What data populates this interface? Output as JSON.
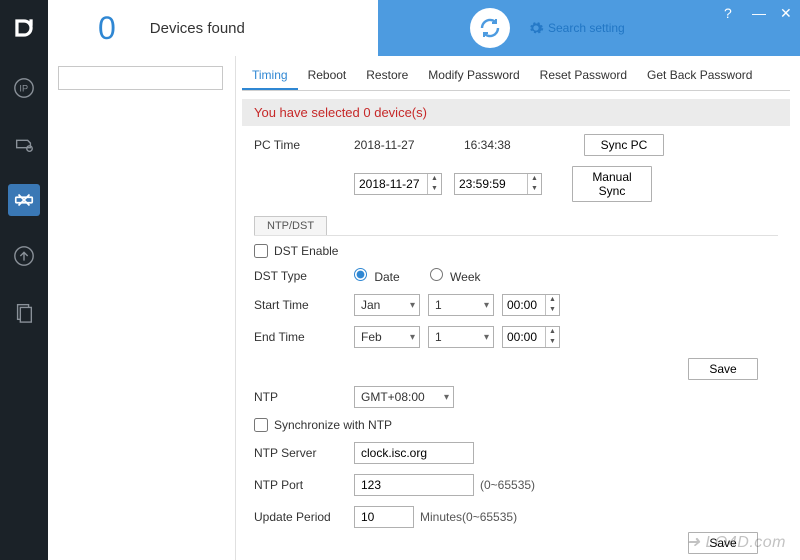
{
  "header": {
    "device_count": "0",
    "device_label": "Devices found",
    "search_setting": "Search setting"
  },
  "tabs": {
    "timing": "Timing",
    "reboot": "Reboot",
    "restore": "Restore",
    "modify_pw": "Modify Password",
    "reset_pw": "Reset Password",
    "getback_pw": "Get Back Password"
  },
  "banner": "You have selected 0 device(s)",
  "pctime": {
    "label": "PC Time",
    "date": "2018-11-27",
    "time": "16:34:38",
    "sync_pc_btn": "Sync PC",
    "manual_date": "2018-11-27",
    "manual_time": "23:59:59",
    "manual_sync_btn": "Manual Sync"
  },
  "ntpdst_tab": "NTP/DST",
  "dst": {
    "enable_label": "DST Enable",
    "type_label": "DST Type",
    "type_date": "Date",
    "type_week": "Week",
    "start_label": "Start Time",
    "start_month": "Jan",
    "start_day": "1",
    "start_time": "00:00",
    "end_label": "End Time",
    "end_month": "Feb",
    "end_day": "1",
    "end_time": "00:00"
  },
  "save_btn": "Save",
  "ntp": {
    "label": "NTP",
    "tz": "GMT+08:00",
    "sync_label": "Synchronize with NTP",
    "server_label": "NTP Server",
    "server_value": "clock.isc.org",
    "port_label": "NTP Port",
    "port_value": "123",
    "port_hint": "(0~65535)",
    "period_label": "Update Period",
    "period_value": "10",
    "period_hint": "Minutes(0~65535)"
  },
  "watermark": "➜ LO4D.com"
}
